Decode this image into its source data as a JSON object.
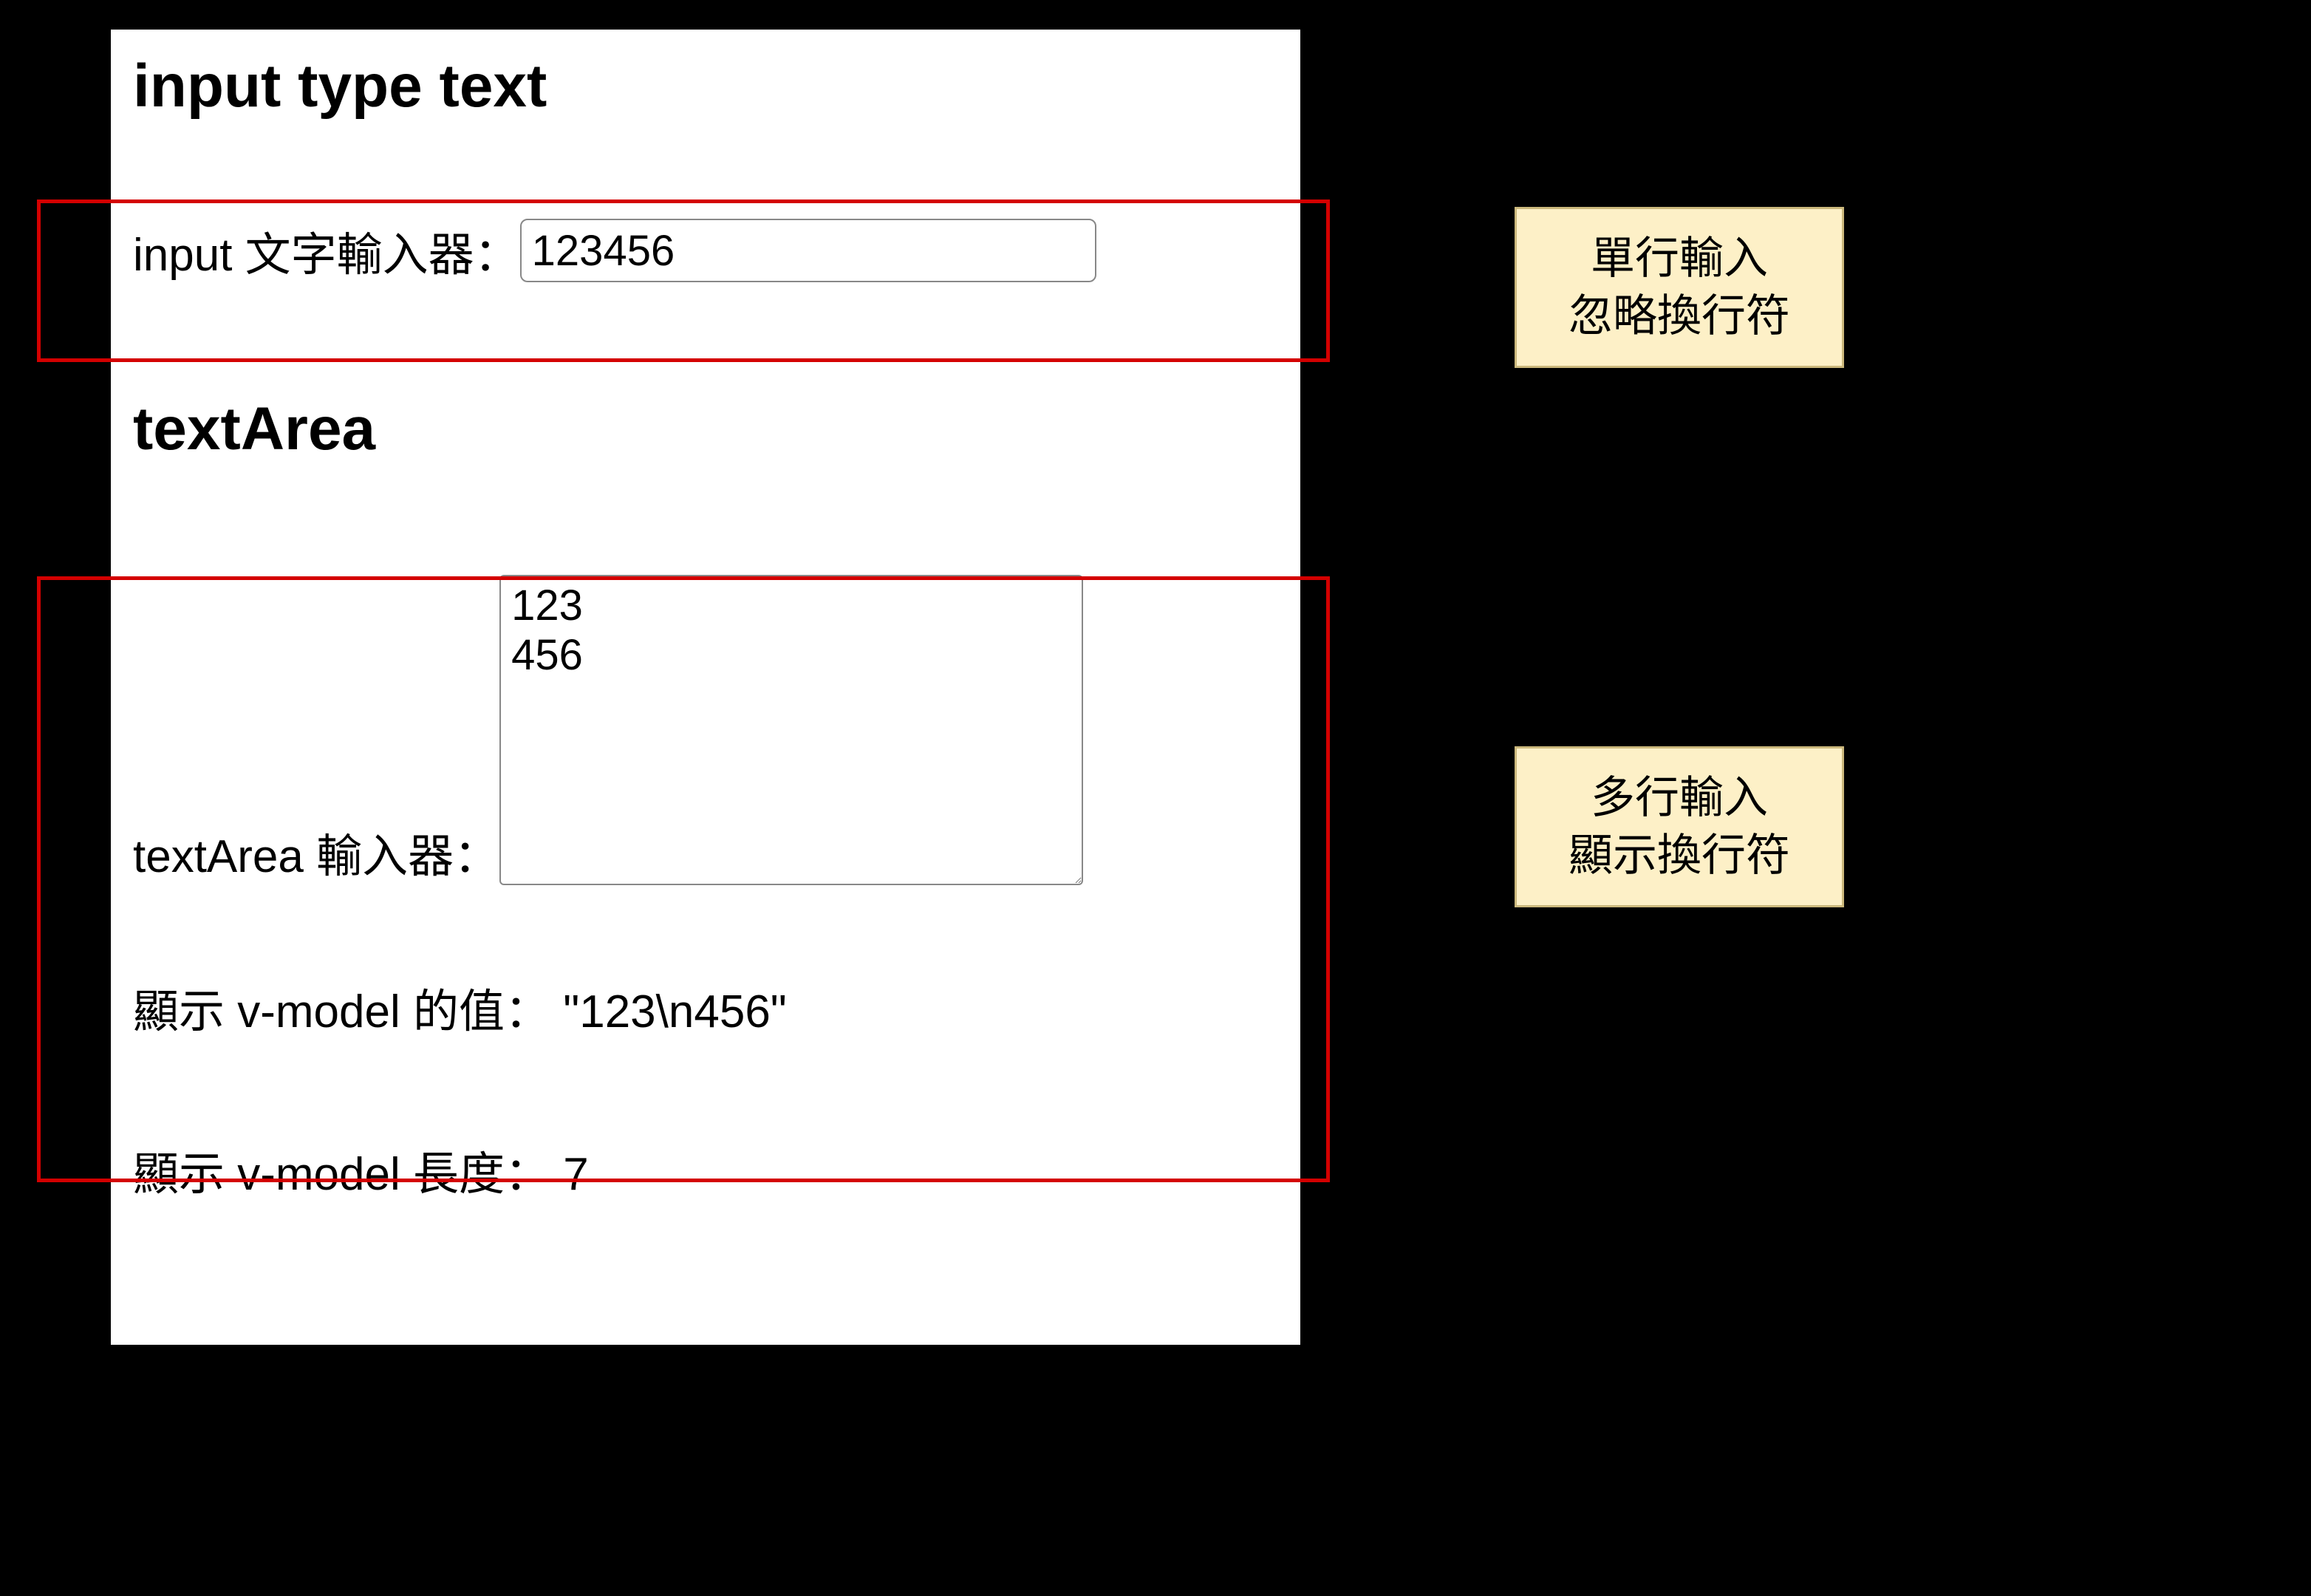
{
  "section_input": {
    "heading": "input type text",
    "label": "input 文字輸入器：",
    "value": "123456"
  },
  "section_textarea": {
    "heading": "textArea",
    "label": "textArea 輸入器：",
    "value": "123\n456",
    "vmodel_label": "顯示 v-model 的值：",
    "vmodel_value": "\"123\\n456\"",
    "length_label": "顯示 v-model 長度：",
    "length_value": "7"
  },
  "callouts": {
    "single_line": "單行輸入\n忽略換行符",
    "multi_line": "多行輸入\n顯示換行符"
  }
}
